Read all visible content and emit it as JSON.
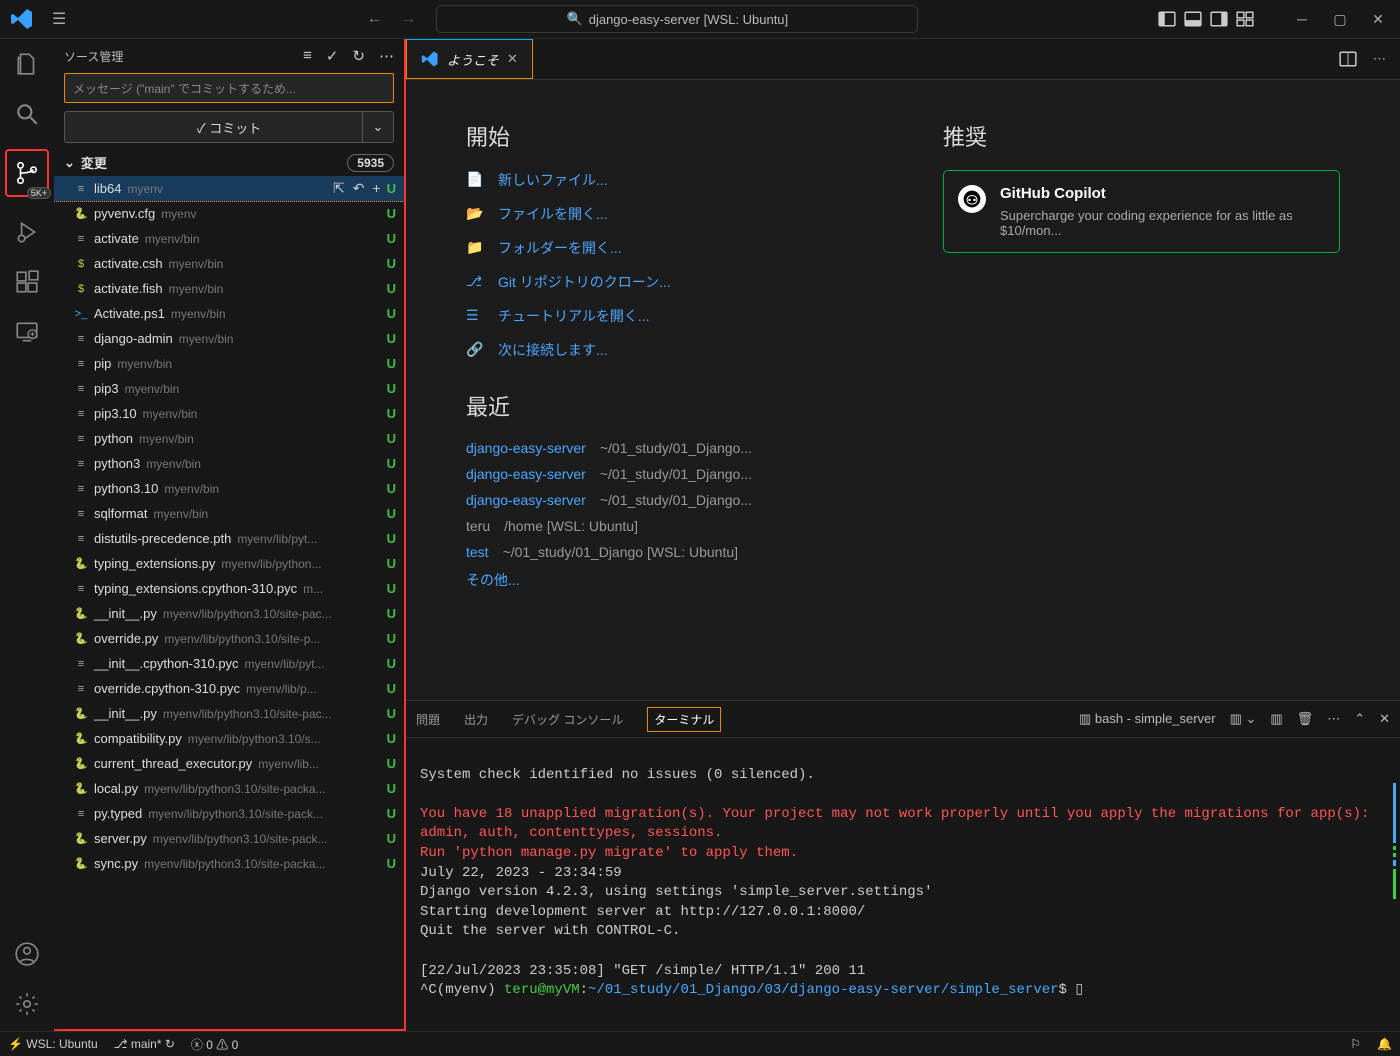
{
  "titlebar": {
    "search": "django-easy-server [WSL: Ubuntu]"
  },
  "activity": {
    "scm_badge": "5K+"
  },
  "sidebar": {
    "title": "ソース管理",
    "message_placeholder": "メッセージ (\"main\" でコミットするため...",
    "commit_label": "✓ コミット",
    "changes_label": "変更",
    "changes_count": "5935",
    "status": "U",
    "items": [
      {
        "name": "lib64",
        "path": "myenv",
        "icon": "txt",
        "sel": true
      },
      {
        "name": "pyvenv.cfg",
        "path": "myenv",
        "icon": "py"
      },
      {
        "name": "activate",
        "path": "myenv/bin",
        "icon": "txt"
      },
      {
        "name": "activate.csh",
        "path": "myenv/bin",
        "icon": "sh"
      },
      {
        "name": "activate.fish",
        "path": "myenv/bin",
        "icon": "sh"
      },
      {
        "name": "Activate.ps1",
        "path": "myenv/bin",
        "icon": "ps1"
      },
      {
        "name": "django-admin",
        "path": "myenv/bin",
        "icon": "txt"
      },
      {
        "name": "pip",
        "path": "myenv/bin",
        "icon": "txt"
      },
      {
        "name": "pip3",
        "path": "myenv/bin",
        "icon": "txt"
      },
      {
        "name": "pip3.10",
        "path": "myenv/bin",
        "icon": "txt"
      },
      {
        "name": "python",
        "path": "myenv/bin",
        "icon": "txt"
      },
      {
        "name": "python3",
        "path": "myenv/bin",
        "icon": "txt"
      },
      {
        "name": "python3.10",
        "path": "myenv/bin",
        "icon": "txt"
      },
      {
        "name": "sqlformat",
        "path": "myenv/bin",
        "icon": "txt"
      },
      {
        "name": "distutils-precedence.pth",
        "path": "myenv/lib/pyt...",
        "icon": "txt"
      },
      {
        "name": "typing_extensions.py",
        "path": "myenv/lib/python...",
        "icon": "py"
      },
      {
        "name": "typing_extensions.cpython-310.pyc",
        "path": "m...",
        "icon": "txt"
      },
      {
        "name": "__init__.py",
        "path": "myenv/lib/python3.10/site-pac...",
        "icon": "py"
      },
      {
        "name": "override.py",
        "path": "myenv/lib/python3.10/site-p...",
        "icon": "py"
      },
      {
        "name": "__init__.cpython-310.pyc",
        "path": "myenv/lib/pyt...",
        "icon": "txt"
      },
      {
        "name": "override.cpython-310.pyc",
        "path": "myenv/lib/p...",
        "icon": "txt"
      },
      {
        "name": "__init__.py",
        "path": "myenv/lib/python3.10/site-pac...",
        "icon": "py"
      },
      {
        "name": "compatibility.py",
        "path": "myenv/lib/python3.10/s...",
        "icon": "py"
      },
      {
        "name": "current_thread_executor.py",
        "path": "myenv/lib...",
        "icon": "py"
      },
      {
        "name": "local.py",
        "path": "myenv/lib/python3.10/site-packa...",
        "icon": "py"
      },
      {
        "name": "py.typed",
        "path": "myenv/lib/python3.10/site-pack...",
        "icon": "txt"
      },
      {
        "name": "server.py",
        "path": "myenv/lib/python3.10/site-pack...",
        "icon": "py"
      },
      {
        "name": "sync.py",
        "path": "myenv/lib/python3.10/site-packa...",
        "icon": "py"
      }
    ]
  },
  "editor": {
    "tab_label": "ようこそ",
    "start_title": "開始",
    "start_links": [
      "新しいファイル...",
      "ファイルを開く...",
      "フォルダーを開く...",
      "Git リポジトリのクローン...",
      "チュートリアルを開く...",
      "次に接続します..."
    ],
    "recent_title": "最近",
    "recent": [
      {
        "name": "django-easy-server",
        "path": "~/01_study/01_Django..."
      },
      {
        "name": "django-easy-server",
        "path": "~/01_study/01_Django..."
      },
      {
        "name": "django-easy-server",
        "path": "~/01_study/01_Django..."
      },
      {
        "name": "teru",
        "path": "/home [WSL: Ubuntu]",
        "dim": true
      },
      {
        "name": "test",
        "path": "~/01_study/01_Django [WSL: Ubuntu]"
      }
    ],
    "recent_more": "その他...",
    "rec_title": "推奨",
    "rec_card": {
      "title": "GitHub Copilot",
      "desc": "Supercharge your coding experience for as little as $10/mon..."
    }
  },
  "panel": {
    "tabs": [
      "問題",
      "出力",
      "デバッグ コンソール",
      "ターミナル"
    ],
    "term_dropdown": "bash - simple_server",
    "term": {
      "l1": "System check identified no issues (0 silenced).",
      "l2": "You have 18 unapplied migration(s). Your project may not work properly until you apply the migrations for app(s): admin, auth, contenttypes, sessions.",
      "l3": "Run 'python manage.py migrate' to apply them.",
      "l4": "July 22, 2023 - 23:34:59",
      "l5": "Django version 4.2.3, using settings 'simple_server.settings'",
      "l6": "Starting development server at http://127.0.0.1:8000/",
      "l7": "Quit the server with CONTROL-C.",
      "l8": "[22/Jul/2023 23:35:08] \"GET /simple/ HTTP/1.1\" 200 11",
      "l9a": "^C(myenv) ",
      "l9b": "teru@myVM",
      "l9c": ":",
      "l9d": "~/01_study/01_Django/03/django-easy-server/simple_server",
      "l9e": "$ ▯"
    }
  },
  "statusbar": {
    "remote": "WSL: Ubuntu",
    "branch": "main*",
    "errors": "0",
    "warnings": "0"
  }
}
